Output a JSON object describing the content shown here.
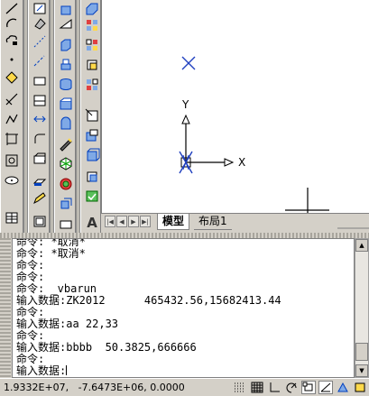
{
  "toolbars": {
    "draw": [
      "line-icon",
      "arc-icon",
      "revision-cloud-icon",
      "point-icon",
      "hatch-icon",
      "xline-icon",
      "spline-icon",
      "polygon-icon",
      "region-icon",
      "table-icon"
    ],
    "modify": [
      "move-icon",
      "copy-icon",
      "rotate-icon",
      "offset-icon",
      "stretch-icon",
      "trim-icon",
      "chamfer-icon",
      "fillet-icon",
      "explode-icon",
      "erase-icon"
    ],
    "solid": [
      "box-icon",
      "cylinder-icon",
      "cone-icon",
      "sphere-icon",
      "torus-icon",
      "wedge-icon",
      "extrude-icon",
      "revolve-icon",
      "section-icon",
      "slice-icon"
    ],
    "view": [
      "3dorbit-icon",
      "visual-style-icon",
      "shade-icon",
      "gouraud-icon",
      "flat-icon",
      "hidden-icon",
      "wireframe-icon",
      "realistic-icon",
      "conceptual-icon",
      "check-icon"
    ]
  },
  "canvas": {
    "ucs_y_label": "Y",
    "ucs_x_label": "X"
  },
  "tabs": {
    "model": "模型",
    "layout1": "布局1"
  },
  "command_history": [
    "命令: *取消*",
    "命令: *取消*",
    "命令:",
    "命令:",
    "命令: _vbarun",
    "输入数据:ZK2012      465432.56,15682413.44",
    "命令:",
    "输入数据:aa 22,33",
    "命令:",
    "输入数据:bbbb  50.3825,666666",
    "命令:"
  ],
  "command_prompt": "输入数据:",
  "status": {
    "coordinates": "1.9332E+07,   -7.6473E+06, 0.0000",
    "toggles": [
      "snap-icon",
      "grid-icon",
      "ortho-icon",
      "polar-icon",
      "osnap-icon",
      "otrack-icon",
      "ducs-icon",
      "dyn-icon"
    ]
  }
}
